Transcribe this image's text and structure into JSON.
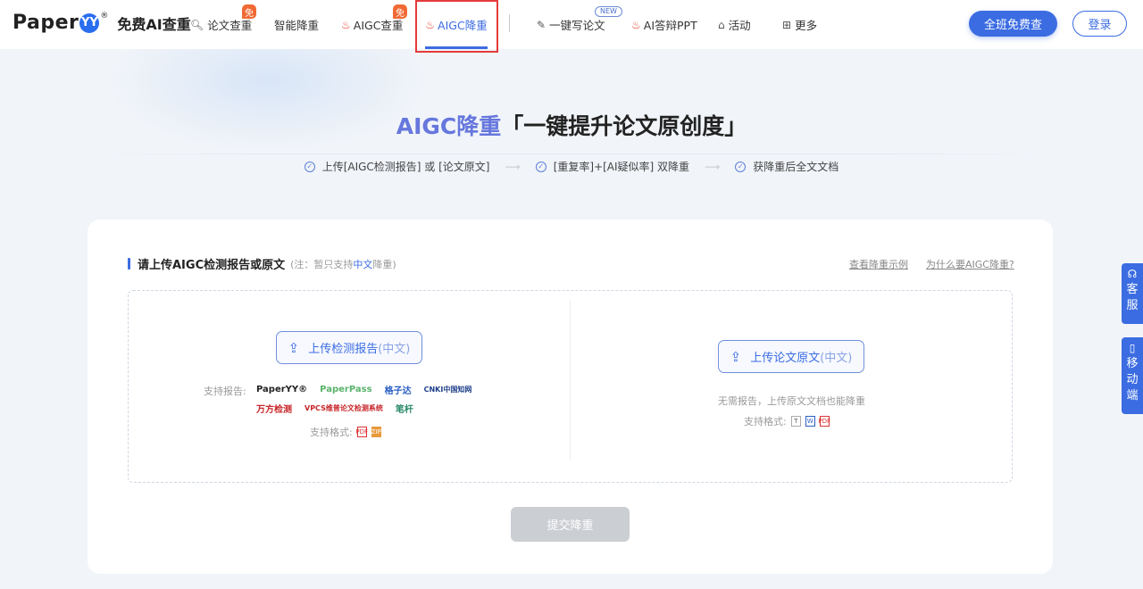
{
  "header": {
    "logo_word": "Paper",
    "logo_mark": "YY",
    "logo_reg": "®",
    "logo_tag": "免费AI查重",
    "nav": [
      {
        "label": "论文查重",
        "icon": "search-doc-icon",
        "badge": "免"
      },
      {
        "label": "智能降重"
      },
      {
        "label": "AIGC查重",
        "icon": "fire-icon",
        "badge": "免"
      },
      {
        "label": "AIGC降重",
        "icon": "fire-icon",
        "active": true
      },
      {
        "label": "一键写论文",
        "icon": "pen-icon",
        "badge": "NEW"
      },
      {
        "label": "AI答辩PPT",
        "icon": "fire-icon"
      },
      {
        "label": "活动",
        "icon": "gift-icon"
      },
      {
        "label": "更多",
        "icon": "grid-icon"
      }
    ],
    "cta_free": "全班免费查",
    "login": "登录"
  },
  "hero": {
    "title_accent": "AIGC降重",
    "title_rest": "「一键提升论文原创度」",
    "steps": [
      "上传[AIGC检测报告] 或 [论文原文]",
      "[重复率]+[AI疑似率] 双降重",
      "获降重后全文文档"
    ]
  },
  "card": {
    "title": "请上传AIGC检测报告或原文",
    "note_prefix": "(注：暂只支持",
    "note_em": "中文",
    "note_suffix": "降重)",
    "link_example": "查看降重示例",
    "link_why": "为什么要AIGC降重?",
    "left": {
      "button": "上传检测报告",
      "button_sub": "(中文)",
      "support_reports_label": "支持报告:",
      "reports_row1": [
        "PaperYY®",
        "PaperPass",
        "格子达",
        "CNKI中国知网"
      ],
      "reports_row2": [
        "万方检测",
        "VPCS维普论文检测系统",
        "笔杆"
      ],
      "support_formats_label": "支持格式:",
      "formats": [
        "PDF",
        "ZIP"
      ]
    },
    "right": {
      "button": "上传论文原文",
      "button_sub": "(中文)",
      "hint": "无需报告，上传原文文档也能降重",
      "support_formats_label": "支持格式:",
      "formats": [
        "T",
        "W",
        "PDF"
      ]
    },
    "submit": "提交降重"
  },
  "side": {
    "service": [
      "客",
      "服"
    ],
    "mobile": [
      "移",
      "动",
      "端"
    ]
  }
}
